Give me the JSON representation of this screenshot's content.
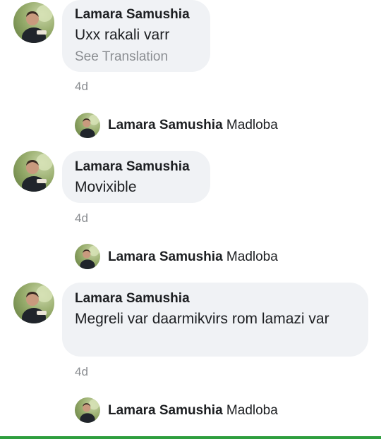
{
  "comments": [
    {
      "author": "Lamara Samushia",
      "text": "Uxx rakali varr",
      "see_translation": "See Translation",
      "time": "4d",
      "reply": {
        "author": "Lamara Samushia",
        "text": "Madloba"
      }
    },
    {
      "author": "Lamara Samushia",
      "text": "Movixible",
      "time": "4d",
      "reply": {
        "author": "Lamara Samushia",
        "text": "Madloba"
      }
    },
    {
      "author": "Lamara Samushia",
      "text": "Megreli var daarmikvirs rom lamazi var",
      "time": "4d",
      "reply": {
        "author": "Lamara Samushia",
        "text": "Madloba"
      }
    }
  ],
  "colors": {
    "bubble": "#f0f2f5",
    "muted": "#8a8d91",
    "bottom_bar": "#2e9e3e"
  },
  "icons": [
    "avatar-photo"
  ]
}
